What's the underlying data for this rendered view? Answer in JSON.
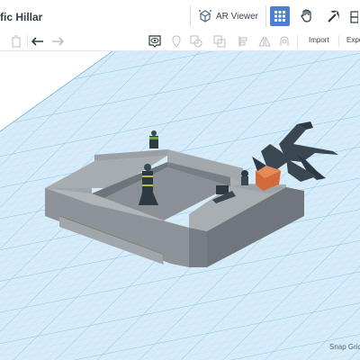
{
  "design": {
    "title": "fic Hillar"
  },
  "header": {
    "ar_viewer_label": "AR Viewer",
    "icons": [
      "ar-cube-icon",
      "grid-view-icon",
      "tinker-hand-icon",
      "pickaxe-icon",
      "blocks-icon"
    ],
    "accent_color": "#4a7fd1"
  },
  "toolbar": {
    "import_label": "Import",
    "export_label": "Expo",
    "icons": [
      "trash-icon",
      "undo-icon",
      "redo-icon",
      "note-visibility-icon",
      "notes-icon",
      "group-icon",
      "ungroup-icon",
      "align-icon",
      "mirror-icon",
      "cruise-icon"
    ]
  },
  "workplane": {
    "snap_grid_label": "Snap Grid",
    "grid_color": "#a8d2f0",
    "plane_color": "#d6ecfa",
    "model_color": "#8e9499",
    "figure_color": "#2d3a44",
    "accent_orange": "#d46a3a"
  }
}
